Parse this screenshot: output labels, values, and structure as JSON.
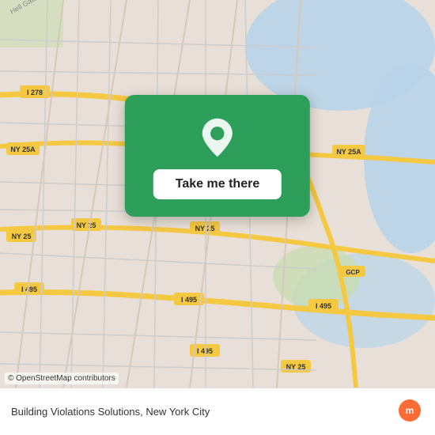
{
  "map": {
    "attribution": "© OpenStreetMap contributors",
    "background_color": "#e8e0d8"
  },
  "popup": {
    "button_label": "Take me there"
  },
  "bottom_bar": {
    "location_text": "Building Violations Solutions, New York City",
    "logo_alt": "moovit"
  },
  "icons": {
    "pin": "location-pin-icon",
    "moovit": "moovit-logo-icon"
  }
}
